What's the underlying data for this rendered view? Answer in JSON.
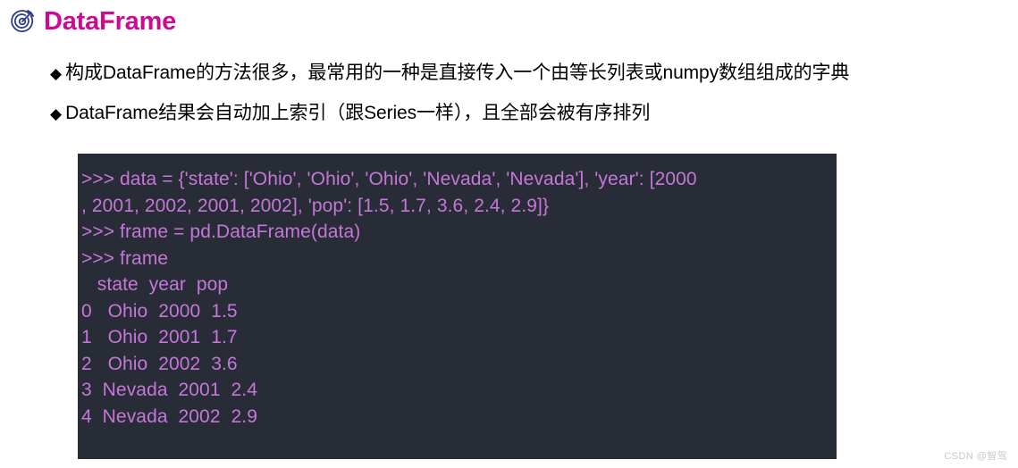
{
  "slide": {
    "title": "DataFrame",
    "title_icon": "target-arrow-icon",
    "title_color": "#cf0a92",
    "icon_color": "#2c3c8c",
    "background_color": "#ffffff"
  },
  "bullets": {
    "marker": "◆",
    "items": [
      "构成DataFrame的方法很多，最常用的一种是直接传入一个由等长列表或numpy数组组成的字典",
      "DataFrame结果会自动加上索引（跟Series一样），且全部会被有序排列"
    ]
  },
  "code_block": {
    "background_color": "#282c37",
    "text_color": "#c577d8",
    "lines": [
      ">>> data = {'state': ['Ohio', 'Ohio', 'Ohio', 'Nevada', 'Nevada'], 'year': [2000",
      ", 2001, 2002, 2001, 2002], 'pop': [1.5, 1.7, 3.6, 2.4, 2.9]}",
      ">>> frame = pd.DataFrame(data)",
      ">>> frame",
      "   state  year  pop",
      "0   Ohio  2000  1.5",
      "1   Ohio  2001  1.7",
      "2   Ohio  2002  3.6",
      "3  Nevada  2001  2.4",
      "4  Nevada  2002  2.9"
    ],
    "dataframe": {
      "columns": [
        "state",
        "year",
        "pop"
      ],
      "index": [
        0,
        1,
        2,
        3,
        4
      ],
      "rows": [
        [
          "Ohio",
          2000,
          1.5
        ],
        [
          "Ohio",
          2001,
          1.7
        ],
        [
          "Ohio",
          2002,
          3.6
        ],
        [
          "Nevada",
          2001,
          2.4
        ],
        [
          "Nevada",
          2002,
          2.9
        ]
      ]
    }
  },
  "watermark": {
    "text": "CSDN @智驾"
  }
}
